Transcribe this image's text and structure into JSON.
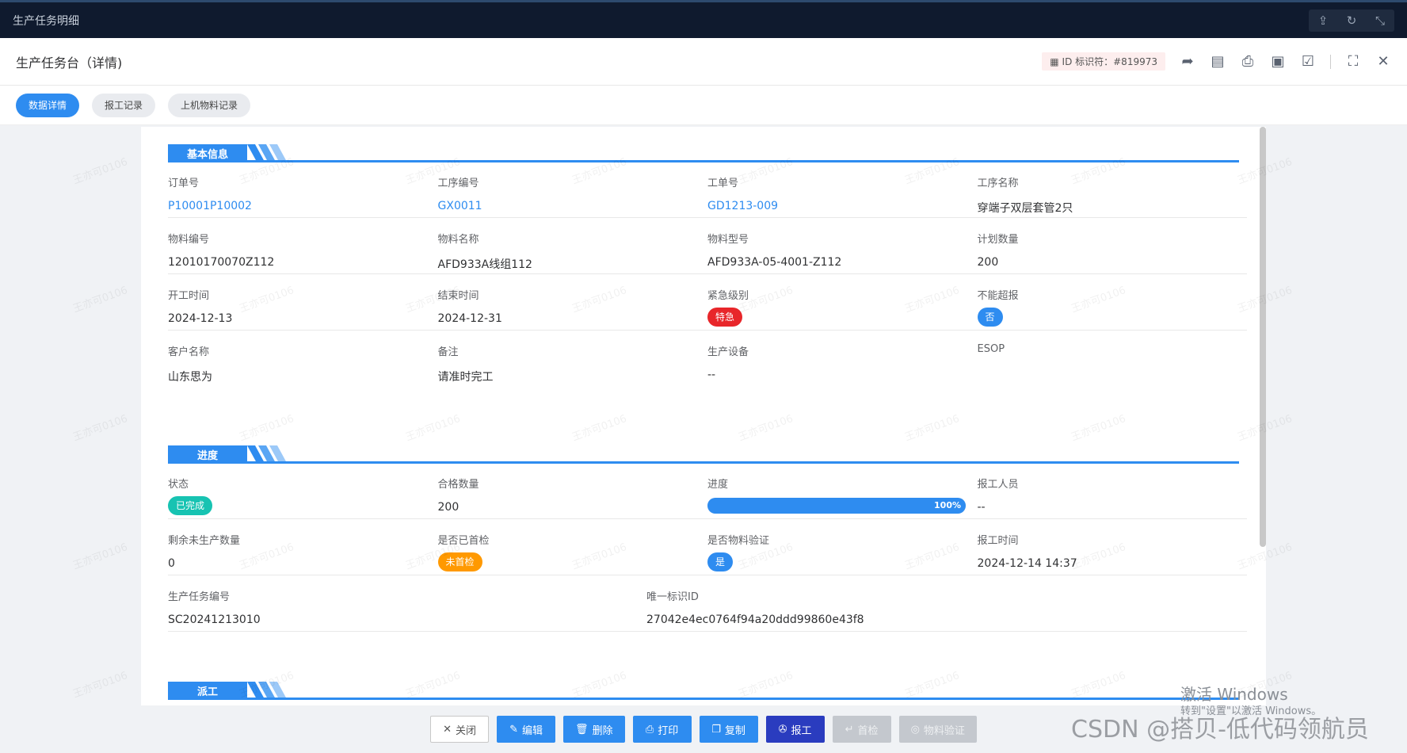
{
  "window": {
    "title": "生产任务明细"
  },
  "header": {
    "title": "生产任务台（详情)",
    "id_label": "ID 标识符：#819973"
  },
  "tabs": [
    {
      "label": "数据详情",
      "active": true
    },
    {
      "label": "报工记录",
      "active": false
    },
    {
      "label": "上机物料记录",
      "active": false
    }
  ],
  "sections": {
    "basic": "基本信息",
    "progress": "进度",
    "dispatch": "派工"
  },
  "basic_rows": [
    [
      {
        "label": "订单号",
        "value": "P10001P10002",
        "type": "link"
      },
      {
        "label": "工序编号",
        "value": "GX0011",
        "type": "link"
      },
      {
        "label": "工单号",
        "value": "GD1213-009",
        "type": "link"
      },
      {
        "label": "工序名称",
        "value": "穿端子双层套管2只",
        "type": "text"
      }
    ],
    [
      {
        "label": "物料编号",
        "value": "12010170070Z112",
        "type": "text"
      },
      {
        "label": "物料名称",
        "value": "AFD933A线组112",
        "type": "text"
      },
      {
        "label": "物料型号",
        "value": "AFD933A-05-4001-Z112",
        "type": "text"
      },
      {
        "label": "计划数量",
        "value": "200",
        "type": "text"
      }
    ],
    [
      {
        "label": "开工时间",
        "value": "2024-12-13",
        "type": "text"
      },
      {
        "label": "结束时间",
        "value": "2024-12-31",
        "type": "text"
      },
      {
        "label": "紧急级别",
        "value": "特急",
        "type": "pill",
        "color": "#e8262a"
      },
      {
        "label": "不能超报",
        "value": "否",
        "type": "pill",
        "color": "#2e8cf0"
      }
    ],
    [
      {
        "label": "客户名称",
        "value": "山东思为",
        "type": "text"
      },
      {
        "label": "备注",
        "value": "请准时完工",
        "type": "text"
      },
      {
        "label": "生产设备",
        "value": "--",
        "type": "text"
      },
      {
        "label": "ESOP",
        "value": "",
        "type": "text"
      }
    ]
  ],
  "progress_rows": [
    [
      {
        "label": "状态",
        "value": "已完成",
        "type": "pill",
        "color": "#17c3b2"
      },
      {
        "label": "合格数量",
        "value": "200",
        "type": "text"
      },
      {
        "label": "进度",
        "value": "100%",
        "type": "progress",
        "fraction": 1.0
      },
      {
        "label": "报工人员",
        "value": "--",
        "type": "text"
      }
    ],
    [
      {
        "label": "剩余未生产数量",
        "value": "0",
        "type": "text"
      },
      {
        "label": "是否已首检",
        "value": "未首检",
        "type": "pill",
        "color": "#ff9900"
      },
      {
        "label": "是否物料验证",
        "value": "是",
        "type": "pill",
        "color": "#2e8cf0"
      },
      {
        "label": "报工时间",
        "value": "2024-12-14 14:37",
        "type": "text"
      }
    ],
    [
      {
        "label": "生产任务编号",
        "value": "SC20241213010",
        "type": "text"
      },
      {
        "label": "唯一标识ID",
        "value": "27042e4ec0764f94a20ddd99860e43f8",
        "type": "text"
      }
    ]
  ],
  "footer": {
    "close": "关闭",
    "edit": "编辑",
    "delete": "删除",
    "print": "打印",
    "copy": "复制",
    "report": "报工",
    "first_check": "首检",
    "material_verify": "物料验证"
  },
  "watermark": "王亦可0106",
  "os_overlay": {
    "activate": "激活 Windows",
    "activate_sub": "转到\"设置\"以激活 Windows。"
  },
  "csdn_mark": "CSDN @搭贝-低代码领航员",
  "colors": {
    "primary": "#2e8cf0",
    "danger": "#e8262a",
    "success": "#17c3b2",
    "warning": "#ff9900",
    "report_btn": "#2a3cbf"
  }
}
